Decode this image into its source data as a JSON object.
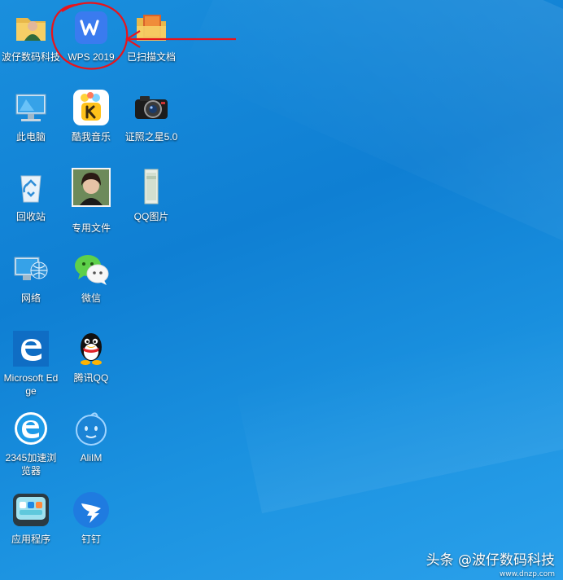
{
  "desktop": {
    "icons": [
      {
        "label": "波仔数码科技",
        "icon": "user-folder-icon"
      },
      {
        "label": "WPS 2019",
        "icon": "wps-icon"
      },
      {
        "label": "已扫描文档",
        "icon": "scanned-folder-icon"
      },
      {
        "label": "此电脑",
        "icon": "computer-icon"
      },
      {
        "label": "酷我音乐",
        "icon": "kuwo-music-icon"
      },
      {
        "label": "证照之星5.0",
        "icon": "camera-icon"
      },
      {
        "label": "回收站",
        "icon": "recycle-bin-icon"
      },
      {
        "label": "专用文件",
        "icon": "photo-file-icon"
      },
      {
        "label": "QQ图片",
        "icon": "image-file-icon"
      },
      {
        "label": "网络",
        "icon": "network-icon"
      },
      {
        "label": "微信",
        "icon": "wechat-icon"
      },
      {
        "label": "Microsoft Edge",
        "icon": "edge-icon"
      },
      {
        "label": "腾讯QQ",
        "icon": "qq-penguin-icon"
      },
      {
        "label": "2345加速浏览器",
        "icon": "ie-browser-icon"
      },
      {
        "label": "AliIM",
        "icon": "aliim-icon"
      },
      {
        "label": "应用程序",
        "icon": "app-folder-icon"
      },
      {
        "label": "钉钉",
        "icon": "dingtalk-icon"
      }
    ]
  },
  "watermark": {
    "text": "头条 @波仔数码科技",
    "sub": "www.dnzp.com"
  },
  "colors": {
    "desktop": "#1688d8",
    "annotation": "#e8141b"
  }
}
